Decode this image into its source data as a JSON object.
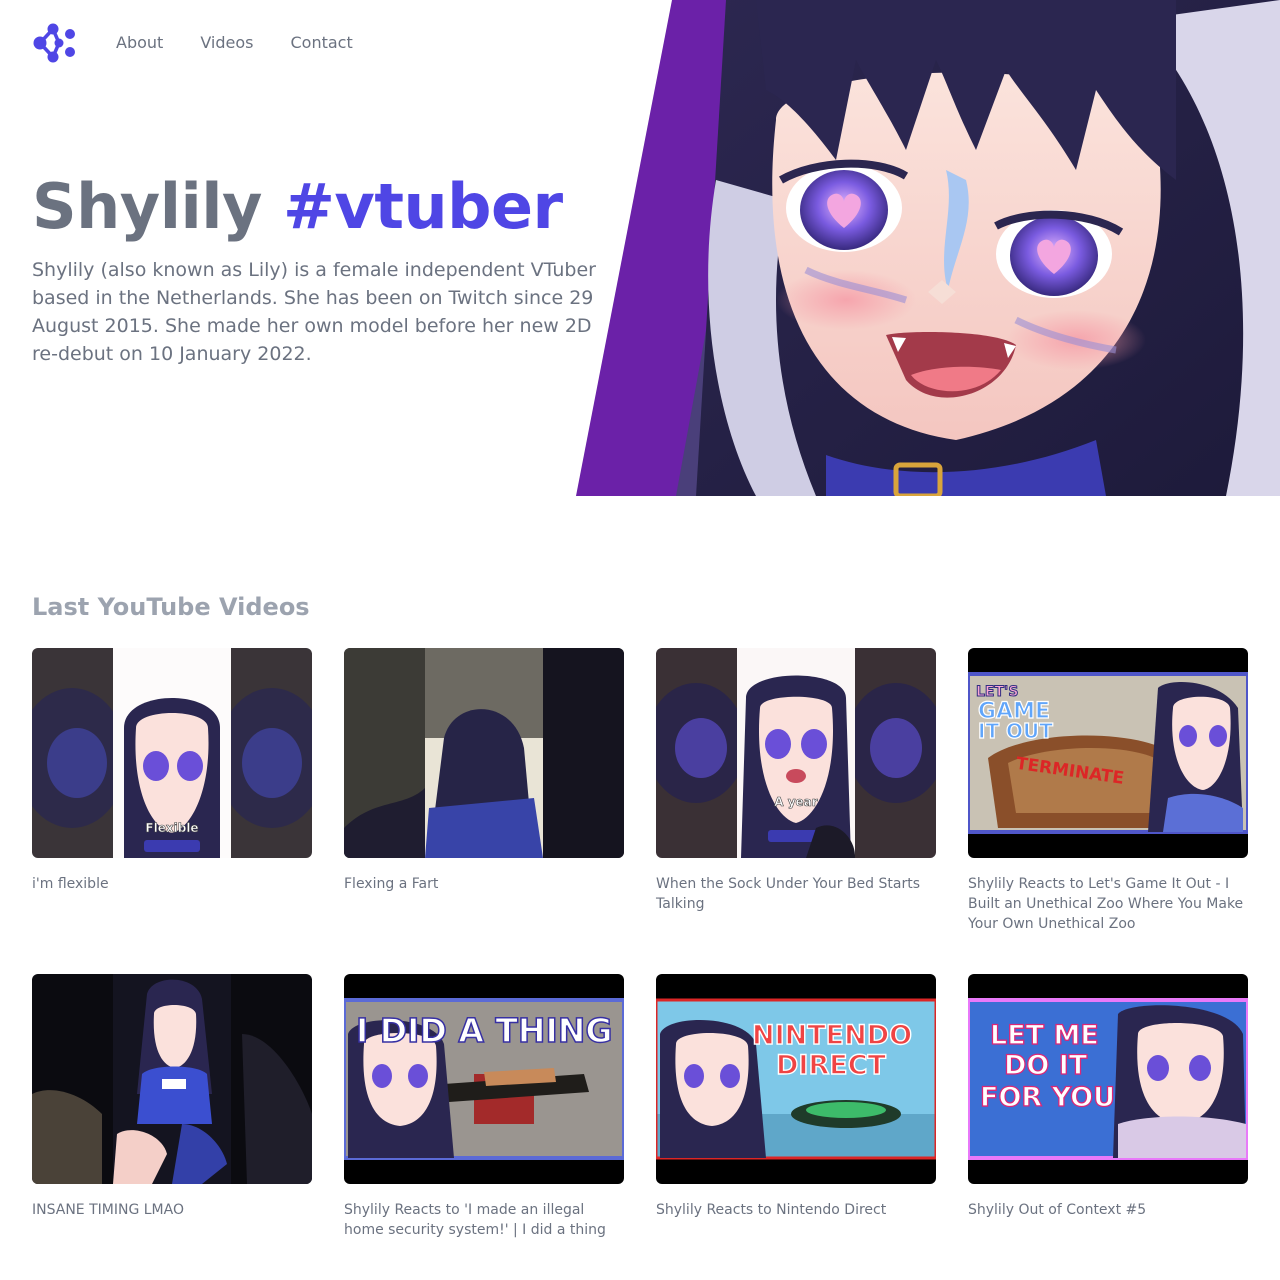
{
  "nav": {
    "logo_icon": "molecule-logo-icon",
    "links": [
      "About",
      "Videos",
      "Contact"
    ]
  },
  "hero": {
    "title_main": "Shylily",
    "title_accent": "#vtuber",
    "description": "Shylily (also known as Lily) is a female independent VTuber based in the Netherlands. She has been on Twitch since 29 August 2015. She made her own model before her new 2D re-debut on 10 January 2022.",
    "accent_color": "#4f46e5",
    "banner_color": "#6b21a8"
  },
  "videos": {
    "heading": "Last YouTube Videos",
    "items": [
      {
        "title": "i'm flexible",
        "thumb_caption": "Flexible",
        "style": "vertical-short"
      },
      {
        "title": "Flexing a Fart",
        "thumb_caption": "",
        "style": "vertical-short"
      },
      {
        "title": "When the Sock Under Your Bed Starts Talking",
        "thumb_caption": "A year",
        "style": "vertical-short"
      },
      {
        "title": "Shylily Reacts to Let's Game It Out - I Built an Unethical Zoo Where You Make Your Own Unethical Zoo",
        "thumb_caption": [
          "LET'S",
          "GAME",
          "IT OUT",
          "TERMINATE"
        ],
        "style": "letterbox"
      },
      {
        "title": "INSANE TIMING LMAO",
        "thumb_caption": "",
        "style": "vertical-short"
      },
      {
        "title": "Shylily Reacts to 'I made an illegal home security system!' | I did a thing",
        "thumb_caption": "I DID A THING",
        "style": "letterbox"
      },
      {
        "title": "Shylily Reacts to Nintendo Direct",
        "thumb_caption": [
          "NINTENDO",
          "DIRECT"
        ],
        "style": "letterbox"
      },
      {
        "title": "Shylily Out of Context #5",
        "thumb_caption": [
          "LET ME",
          "DO IT",
          "FOR YOU"
        ],
        "style": "letterbox"
      }
    ]
  }
}
